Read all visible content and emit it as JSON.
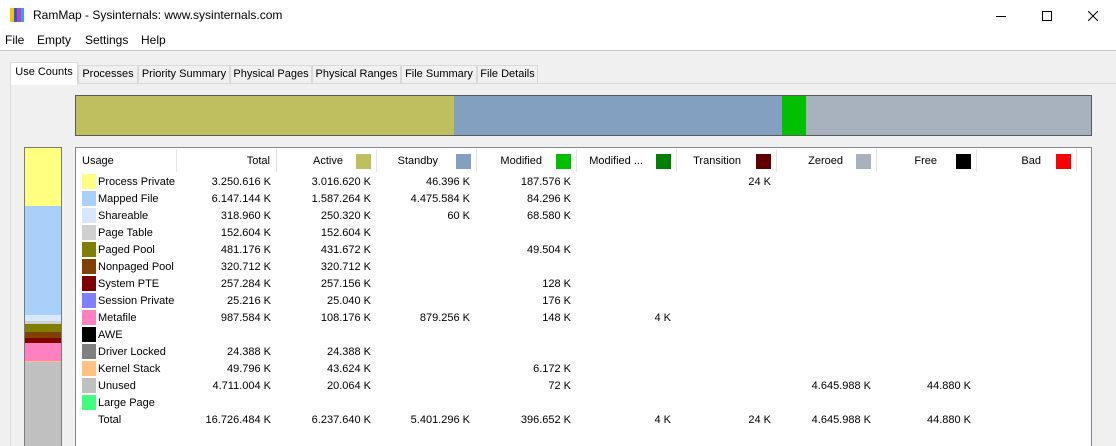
{
  "window": {
    "title": "RamMap - Sysinternals: www.sysinternals.com",
    "icon_colors": [
      "#f7c600",
      "#1f64c8",
      "#c83cc8",
      "#2aa7f0"
    ]
  },
  "menu": [
    "File",
    "Empty",
    "Settings",
    "Help"
  ],
  "tabs": [
    "Use Counts",
    "Processes",
    "Priority Summary",
    "Physical Pages",
    "Physical Ranges",
    "File Summary",
    "File Details"
  ],
  "active_tab": "Use Counts",
  "summary_bar": [
    {
      "name": "Active",
      "color": "#bfbf5f",
      "share": 0.3729
    },
    {
      "name": "Standby",
      "color": "#84a0c0",
      "share": 0.3229
    },
    {
      "name": "Modified",
      "color": "#00c000",
      "share": 0.0237
    },
    {
      "name": "Free",
      "color": "#a7b2be",
      "share": 0.2805
    }
  ],
  "columns": [
    {
      "label": "Usage",
      "swatch": null
    },
    {
      "label": "Total",
      "swatch": null
    },
    {
      "label": "Active",
      "swatch": "#bfbf5f"
    },
    {
      "label": "Standby",
      "swatch": "#84a0c0"
    },
    {
      "label": "Modified",
      "swatch": "#00c000"
    },
    {
      "label": "Modified ...",
      "swatch": "#008000"
    },
    {
      "label": "Transition",
      "swatch": "#600000"
    },
    {
      "label": "Zeroed",
      "swatch": "#a7b2be"
    },
    {
      "label": "Free",
      "swatch": "#000000"
    },
    {
      "label": "Bad",
      "swatch": "#ff0000"
    }
  ],
  "rows": [
    {
      "name": "Process Private",
      "color": "#ffff80",
      "values": [
        "3.250.616 K",
        "3.016.620 K",
        "46.396 K",
        "187.576 K",
        "",
        "24 K",
        "",
        "",
        ""
      ],
      "sidebar_share": 0.1943
    },
    {
      "name": "Mapped File",
      "color": "#a8d0f8",
      "values": [
        "6.147.144 K",
        "1.587.264 K",
        "4.475.584 K",
        "84.296 K",
        "",
        "",
        "",
        "",
        ""
      ],
      "sidebar_share": 0.3675
    },
    {
      "name": "Shareable",
      "color": "#d8e8fc",
      "values": [
        "318.960 K",
        "250.320 K",
        "60 K",
        "68.580 K",
        "",
        "",
        "",
        "",
        ""
      ],
      "sidebar_share": 0.0191
    },
    {
      "name": "Page Table",
      "color": "#d0d0d0",
      "values": [
        "152.604 K",
        "152.604 K",
        "",
        "",
        "",
        "",
        "",
        "",
        ""
      ],
      "sidebar_share": 0.0091
    },
    {
      "name": "Paged Pool",
      "color": "#808000",
      "values": [
        "481.176 K",
        "431.672 K",
        "",
        "49.504 K",
        "",
        "",
        "",
        "",
        ""
      ],
      "sidebar_share": 0.0288
    },
    {
      "name": "Nonpaged Pool",
      "color": "#804000",
      "values": [
        "320.712 K",
        "320.712 K",
        "",
        "",
        "",
        "",
        "",
        "",
        ""
      ],
      "sidebar_share": 0.0192
    },
    {
      "name": "System PTE",
      "color": "#800000",
      "values": [
        "257.284 K",
        "257.156 K",
        "",
        "128 K",
        "",
        "",
        "",
        "",
        ""
      ],
      "sidebar_share": 0.0154
    },
    {
      "name": "Session Private",
      "color": "#8080ff",
      "values": [
        "25.216 K",
        "25.040 K",
        "",
        "176 K",
        "",
        "",
        "",
        "",
        ""
      ],
      "sidebar_share": 0.0015
    },
    {
      "name": "Metafile",
      "color": "#ff80c0",
      "values": [
        "987.584 K",
        "108.176 K",
        "879.256 K",
        "148 K",
        "4 K",
        "",
        "",
        "",
        ""
      ],
      "sidebar_share": 0.059
    },
    {
      "name": "AWE",
      "color": "#000000",
      "values": [
        "",
        "",
        "",
        "",
        "",
        "",
        "",
        "",
        ""
      ],
      "sidebar_share": 0
    },
    {
      "name": "Driver Locked",
      "color": "#808080",
      "values": [
        "24.388 K",
        "24.388 K",
        "",
        "",
        "",
        "",
        "",
        "",
        ""
      ],
      "sidebar_share": 0.0015
    },
    {
      "name": "Kernel Stack",
      "color": "#ffc080",
      "values": [
        "49.796 K",
        "43.624 K",
        "",
        "6.172 K",
        "",
        "",
        "",
        "",
        ""
      ],
      "sidebar_share": 0.003
    },
    {
      "name": "Unused",
      "color": "#c0c0c0",
      "values": [
        "4.711.004 K",
        "20.064 K",
        "",
        "72 K",
        "",
        "",
        "4.645.988 K",
        "44.880 K",
        ""
      ],
      "sidebar_share": 0.2817
    },
    {
      "name": "Large Page",
      "color": "#40ff80",
      "values": [
        "",
        "",
        "",
        "",
        "",
        "",
        "",
        "",
        ""
      ],
      "sidebar_share": 0
    }
  ],
  "total_row": {
    "name": "Total",
    "values": [
      "16.726.484 K",
      "6.237.640 K",
      "5.401.296 K",
      "396.652 K",
      "4 K",
      "24 K",
      "4.645.988 K",
      "44.880 K",
      ""
    ]
  }
}
